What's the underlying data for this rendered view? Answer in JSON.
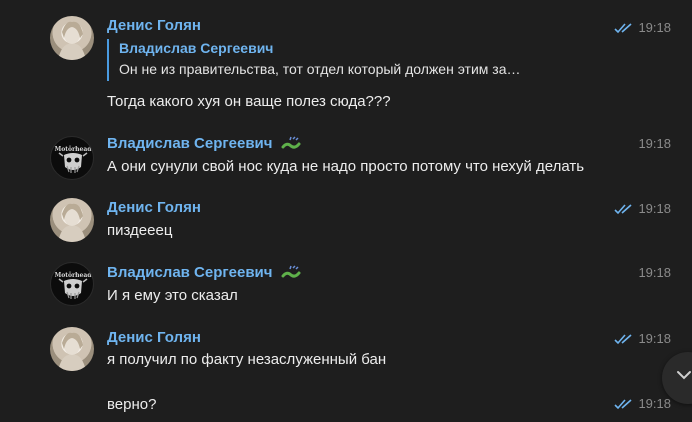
{
  "messages": [
    {
      "author": "Денис Голян",
      "time": "19:18",
      "quote_author": "Владислав Сергеевич",
      "quote_text": "Он не из правительства, тот отдел который должен этим за…",
      "text": "Тогда какого хуя он ваще полез сюда???"
    },
    {
      "author": "Владислав Сергеевич",
      "time": "19:18",
      "text": "А они сунули свой нос куда не надо просто потому что нехуй делать"
    },
    {
      "author": "Денис Голян",
      "time": "19:18",
      "text": "пиздееец"
    },
    {
      "author": "Владислав Сергеевич",
      "time": "19:18",
      "text": "И я ему это сказал"
    },
    {
      "author": "Денис Голян",
      "time": "19:18",
      "text": "я получил по факту незаслуженный бан"
    },
    {
      "author": "",
      "time": "19:18",
      "text": "верно?"
    }
  ],
  "avatar_badge_text": "Motörhead",
  "colors": {
    "background": "#1e1e1e",
    "name": "#6fb4ef",
    "text": "#ededed",
    "time": "#8a8a8a",
    "read_check": "#6fb4ef"
  },
  "icons": {
    "read_status": "double-check-icon",
    "scroll_down": "chevron-down-icon",
    "emoji_status": "snake-emoji-icon"
  }
}
